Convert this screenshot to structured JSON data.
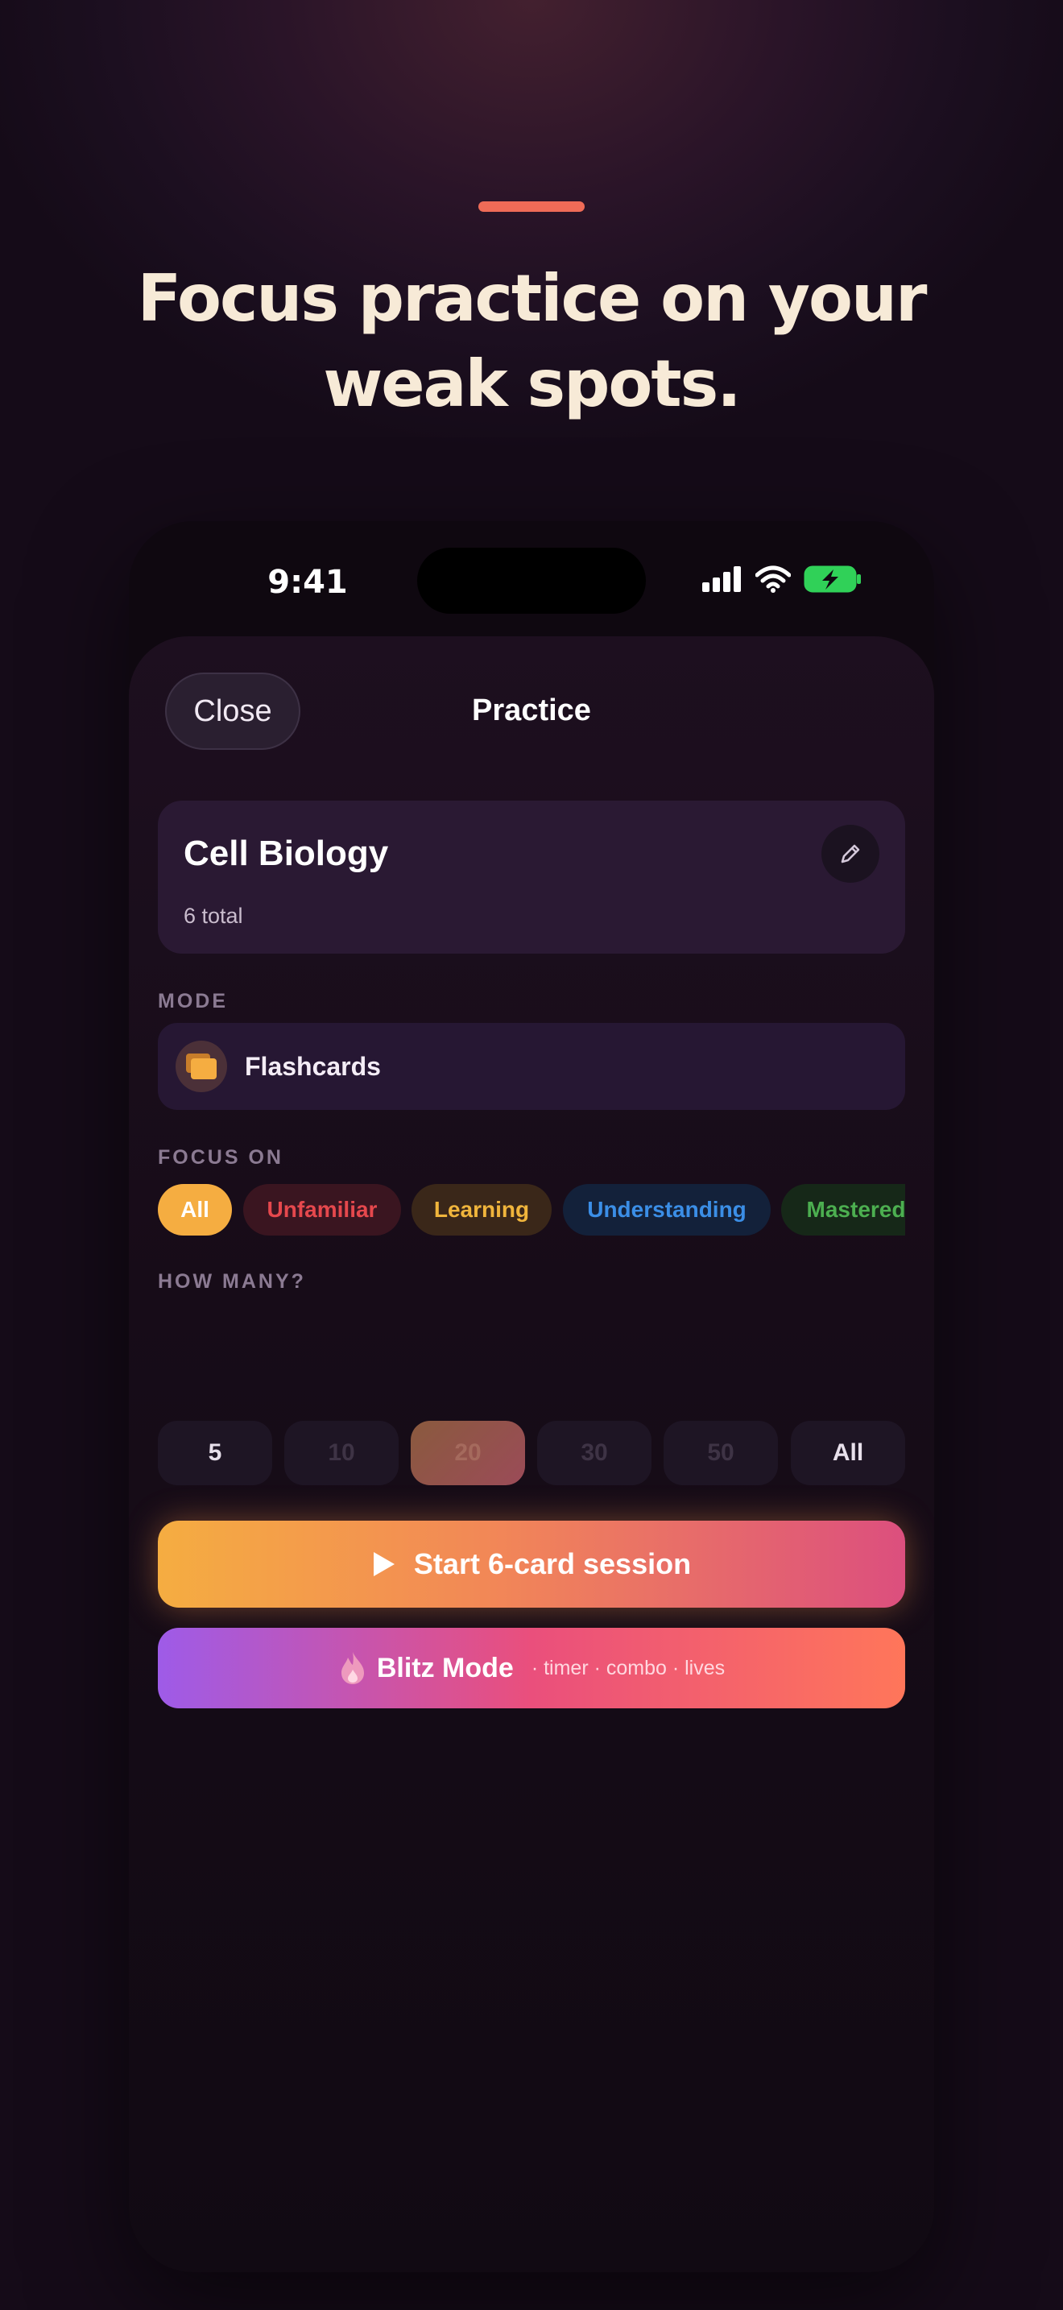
{
  "marketing": {
    "headline_line1": "Focus practice on your",
    "headline_line2": "weak spots."
  },
  "status_bar": {
    "time": "9:41",
    "icons": [
      "cellular-signal-icon",
      "wifi-icon",
      "battery-charging-icon"
    ]
  },
  "header": {
    "close_label": "Close",
    "title": "Practice"
  },
  "deck": {
    "title": "Cell Biology",
    "subtitle": "6 total",
    "edit_icon": "pencil-icon"
  },
  "mode": {
    "section_label": "MODE",
    "selected": "Flashcards",
    "icon": "cards-icon"
  },
  "focus": {
    "section_label": "FOCUS ON",
    "chips": [
      {
        "label": "All",
        "selected": true,
        "color": "#f5ad41"
      },
      {
        "label": "Unfamiliar",
        "selected": false,
        "color": "#e5484d"
      },
      {
        "label": "Learning",
        "selected": false,
        "color": "#f0b53c"
      },
      {
        "label": "Understanding",
        "selected": false,
        "color": "#3b8ee6"
      },
      {
        "label": "Mastered",
        "selected": false,
        "color": "#4caf50"
      }
    ]
  },
  "how_many": {
    "section_label": "HOW MANY?",
    "options": [
      {
        "label": "5",
        "enabled": true,
        "selected": false
      },
      {
        "label": "10",
        "enabled": false,
        "selected": false
      },
      {
        "label": "20",
        "enabled": false,
        "selected": true
      },
      {
        "label": "30",
        "enabled": false,
        "selected": false
      },
      {
        "label": "50",
        "enabled": false,
        "selected": false
      },
      {
        "label": "All",
        "enabled": true,
        "selected": false
      }
    ]
  },
  "actions": {
    "start_label": "Start 6-card session",
    "start_icon": "play-icon",
    "blitz_label": "Blitz Mode",
    "blitz_subtitle": "· timer · combo · lives",
    "blitz_icon": "flame-icon"
  },
  "colors": {
    "accent": "#ef6b57",
    "headline": "#f7ead7",
    "card_bg": "#2a1933"
  }
}
